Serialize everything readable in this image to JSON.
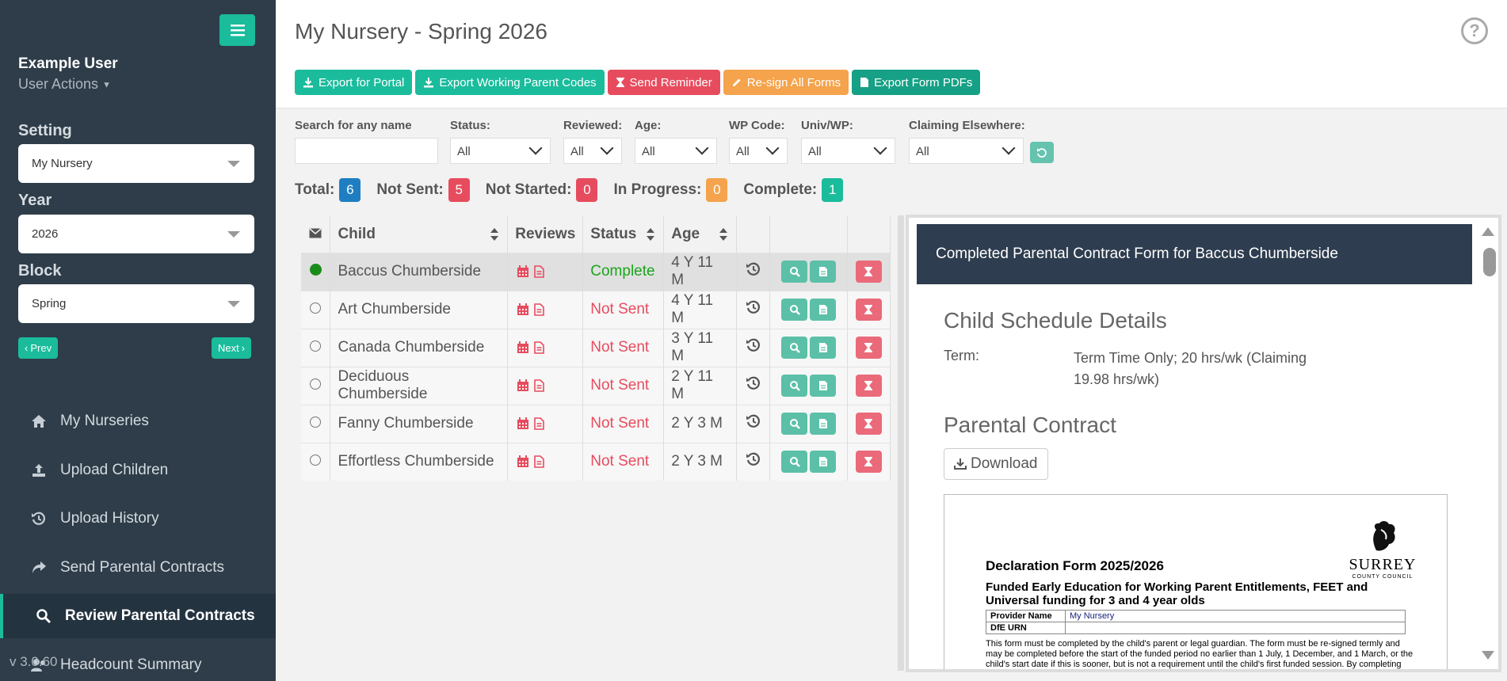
{
  "sidebar": {
    "user_name": "Example User",
    "user_actions": "User Actions",
    "setting_label": "Setting",
    "setting_value": "My Nursery",
    "year_label": "Year",
    "year_value": "2026",
    "block_label": "Block",
    "block_value": "Spring",
    "prev_label": "Prev",
    "next_label": "Next",
    "nav": [
      {
        "label": "My Nurseries",
        "icon": "home-icon"
      },
      {
        "label": "Upload Children",
        "icon": "upload-icon"
      },
      {
        "label": "Upload History",
        "icon": "history-icon"
      },
      {
        "label": "Send Parental Contracts",
        "icon": "share-icon"
      },
      {
        "label": "Review Parental Contracts",
        "icon": "search-icon"
      },
      {
        "label": "Headcount Summary",
        "icon": "users-icon"
      }
    ],
    "version": "v 3.0.60"
  },
  "header": {
    "title": "My Nursery - Spring 2026",
    "buttons": [
      "Export for Portal",
      "Export Working Parent Codes",
      "Send Reminder",
      "Re-sign All Forms",
      "Export Form PDFs"
    ]
  },
  "filters": {
    "search_label": "Search for any name",
    "search_value": "",
    "status_label": "Status:",
    "status_value": "All",
    "reviewed_label": "Reviewed:",
    "reviewed_value": "All",
    "age_label": "Age:",
    "age_value": "All",
    "wp_label": "WP Code:",
    "wp_value": "All",
    "univ_label": "Univ/WP:",
    "univ_value": "All",
    "claim_label": "Claiming Elsewhere:",
    "claim_value": "All"
  },
  "counts": {
    "total_label": "Total:",
    "total": "6",
    "notsent_label": "Not Sent:",
    "notsent": "5",
    "notstarted_label": "Not Started:",
    "notstarted": "0",
    "inprogress_label": "In Progress:",
    "inprogress": "0",
    "complete_label": "Complete:",
    "complete": "1"
  },
  "table": {
    "headers": {
      "child": "Child",
      "reviews": "Reviews",
      "status": "Status",
      "age": "Age"
    },
    "rows": [
      {
        "child": "Baccus Chumberside",
        "status": "Complete",
        "age": "4 Y 11 M"
      },
      {
        "child": "Art Chumberside",
        "status": "Not Sent",
        "age": "4 Y 11 M"
      },
      {
        "child": "Canada Chumberside",
        "status": "Not Sent",
        "age": "3 Y 11 M"
      },
      {
        "child": "Deciduous Chumberside",
        "status": "Not Sent",
        "age": "2 Y 11 M"
      },
      {
        "child": "Fanny Chumberside",
        "status": "Not Sent",
        "age": "2 Y 3 M"
      },
      {
        "child": "Effortless Chumberside",
        "status": "Not Sent",
        "age": "2 Y 3 M"
      }
    ]
  },
  "panel": {
    "header": "Completed Parental Contract Form for Baccus Chumberside",
    "schedule_title": "Child Schedule Details",
    "term_label": "Term:",
    "term_value": "Term Time Only; 20 hrs/wk (Claiming 19.98 hrs/wk)",
    "contract_title": "Parental Contract",
    "download_label": "Download",
    "doc": {
      "title": "Declaration Form 2025/2026",
      "subtitle": "Funded Early Education for Working Parent Entitlements, FEET and Universal funding for 3 and 4 year olds",
      "provider_label": "Provider Name",
      "provider_value": "My Nursery",
      "urn_label": "DfE URN",
      "body": "This form must be completed by the child's parent or legal guardian.  The form must be re-signed termly and may be completed before the start of the funded period no earlier than 1 July, 1 December, and 1 March, or the child's start date if this is sooner, but is not a requirement until the child's first funded session. By completing this",
      "logo_name": "SURREY",
      "logo_sub": "COUNTY COUNCIL"
    }
  },
  "colors": {
    "accent": "#1abc9c",
    "danger": "#e74c5e",
    "warning": "#f5a34c",
    "sidebar": "#2e3d49",
    "primary_badge": "#1f7ec2"
  }
}
